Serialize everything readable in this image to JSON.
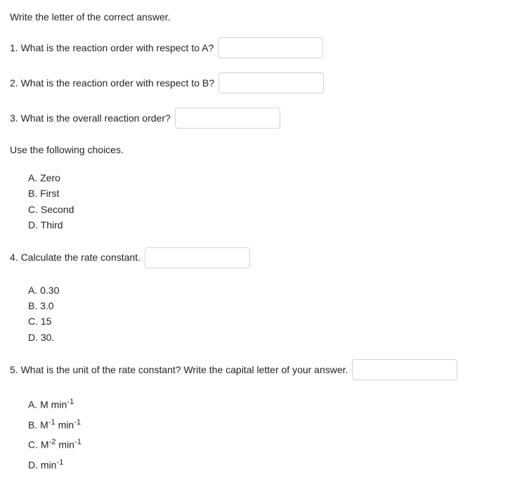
{
  "instruction": "Write the letter of the correct answer.",
  "q1": {
    "text": "1. What is the reaction order with respect to A?"
  },
  "q2": {
    "text": "2. What is the reaction order with respect to B?"
  },
  "q3": {
    "text": "3. What is the overall reaction order?"
  },
  "choices_intro": "Use the following choices.",
  "choices1": {
    "a": "A. Zero",
    "b": "B. First",
    "c": "C. Second",
    "d": "D. Third"
  },
  "q4": {
    "text": "4. Calculate the rate constant."
  },
  "choices4": {
    "a": "A. 0.30",
    "b": "B. 3.0",
    "c": "C. 15",
    "d": "D. 30."
  },
  "q5": {
    "text": "5. What is the unit of the rate constant? Write the capital letter of your answer."
  },
  "choices5": {
    "a_prefix": "A. M min",
    "a_sup": "-1",
    "b_prefix": "B. M",
    "b_sup1": "-1",
    "b_mid": " min",
    "b_sup2": "-1",
    "c_prefix": "C. M",
    "c_sup1": "-2",
    "c_mid": " min",
    "c_sup2": "-1",
    "d_prefix": "D. min",
    "d_sup": "-1"
  }
}
